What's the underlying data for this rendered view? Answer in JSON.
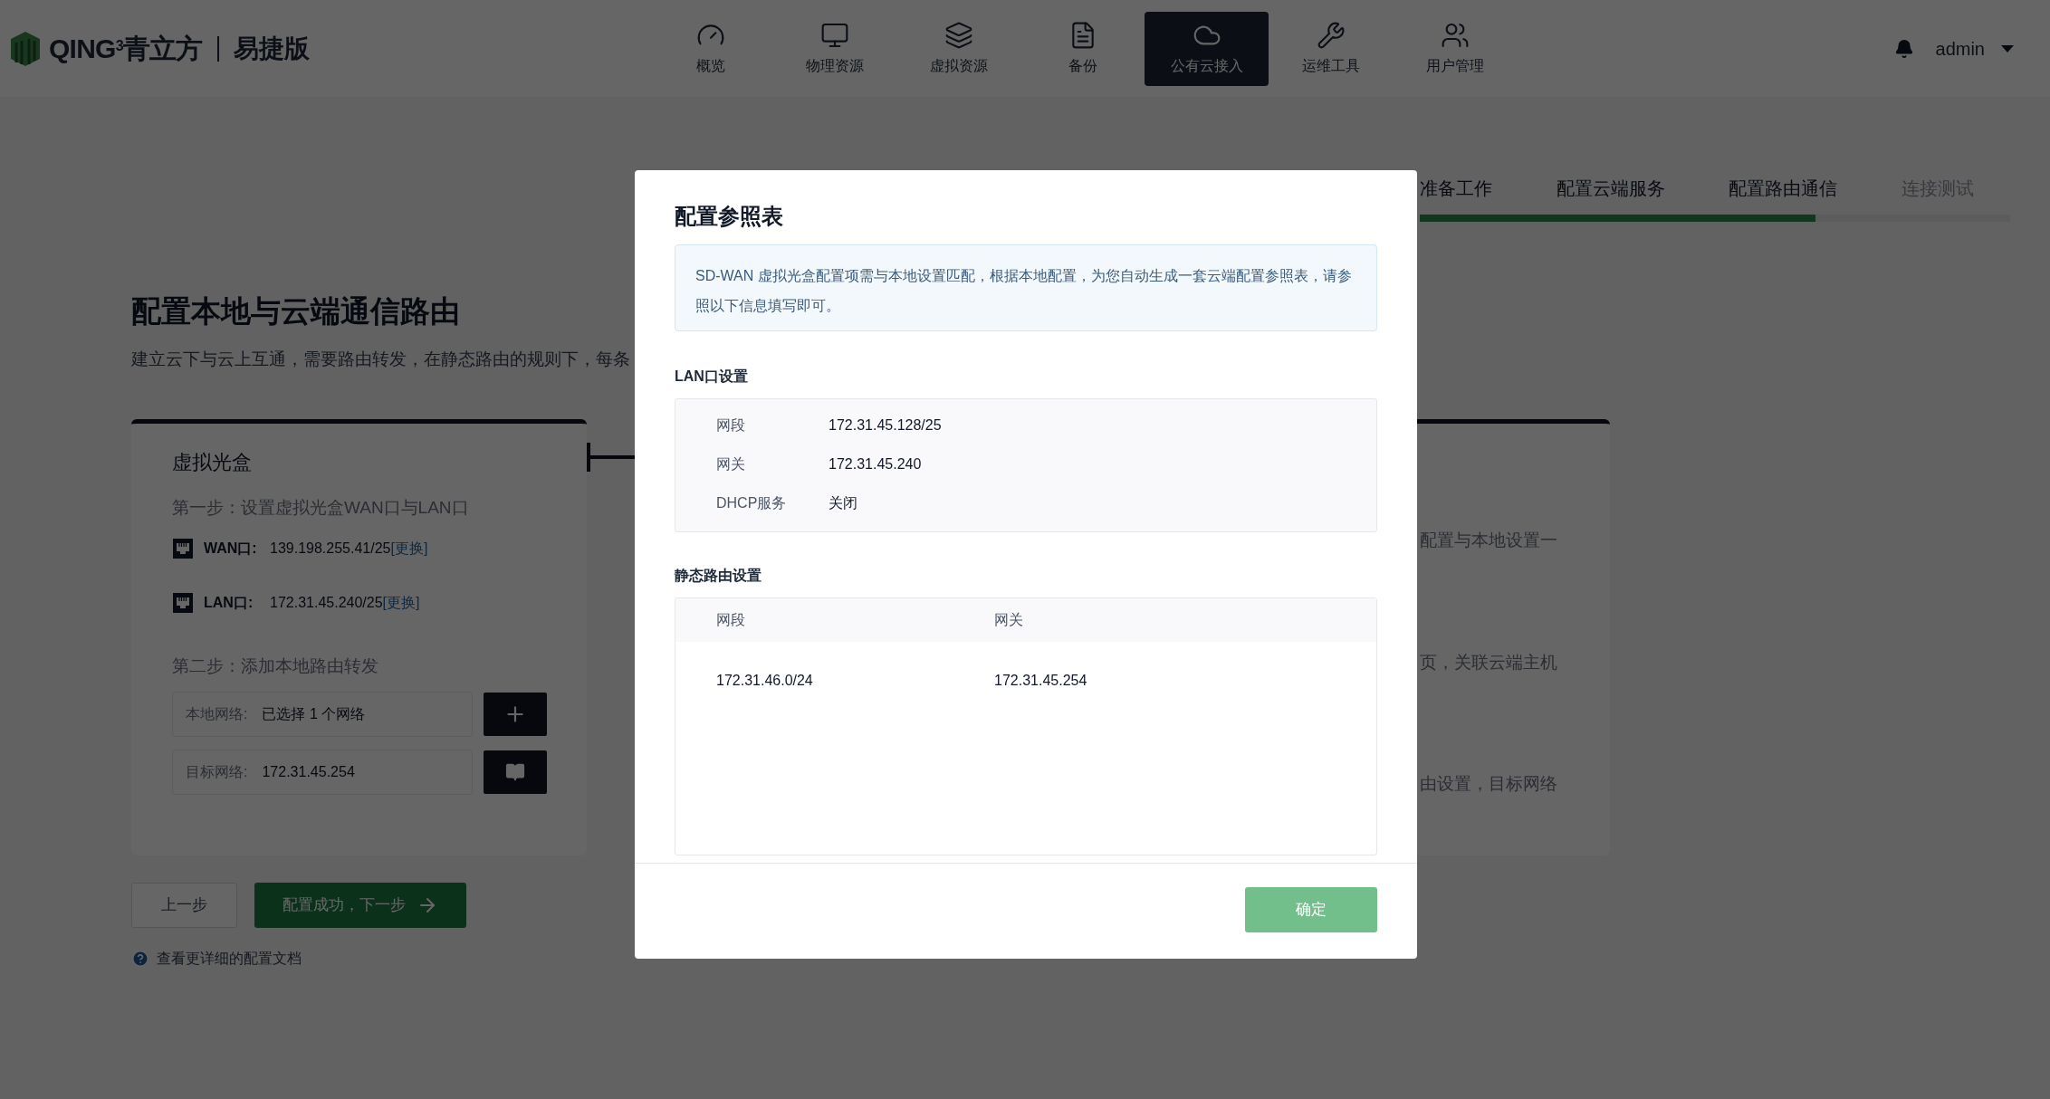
{
  "header": {
    "logo_text": "QING",
    "logo_sup": "3",
    "brand": "青立方",
    "edition": "易捷版",
    "nav": [
      {
        "label": "概览",
        "selected": false
      },
      {
        "label": "物理资源",
        "selected": false
      },
      {
        "label": "虚拟资源",
        "selected": false
      },
      {
        "label": "备份",
        "selected": false
      },
      {
        "label": "公有云接入",
        "selected": true
      },
      {
        "label": "运维工具",
        "selected": false
      },
      {
        "label": "用户管理",
        "selected": false
      }
    ],
    "user": "admin"
  },
  "steps": {
    "items": [
      {
        "label": "准备工作",
        "disabled": false
      },
      {
        "label": "配置云端服务",
        "disabled": false
      },
      {
        "label": "配置路由通信",
        "disabled": false
      },
      {
        "label": "连接测试",
        "disabled": true
      }
    ],
    "level": 0.67
  },
  "page": {
    "title": "配置本地与云端通信路由",
    "description": "建立云下与云上互通，需要路由转发，在静态路由的规则下，每条",
    "left_card": {
      "title": "虚拟光盒",
      "step1": "第一步：设置虚拟光盒WAN口与LAN口",
      "ports": [
        {
          "label": "WAN口:",
          "value": "139.198.255.41/25",
          "link": "[更换]"
        },
        {
          "label": "LAN口:",
          "value": "172.31.45.240/25",
          "link": "[更换]"
        }
      ],
      "step2": "第二步：添加本地路由转发",
      "fields": [
        {
          "label": "本地网络:",
          "value": "已选择 1 个网络",
          "kind": "add"
        },
        {
          "label": "目标网络:",
          "value": "172.31.45.254",
          "kind": "info"
        }
      ]
    },
    "right_card": {
      "lines": [
        "配置与本地设置一",
        "页，关联云端主机",
        "由设置，目标网络"
      ]
    },
    "back_button": "上一步",
    "next_button": "配置成功，下一步",
    "help_link": "查看更详细的配置文档"
  },
  "modal": {
    "title": "配置参照表",
    "notice": "SD-WAN 虚拟光盒配置项需与本地设置匹配，根据本地配置，为您自动生成一套云端配置参照表，请参照以下信息填写即可。",
    "lan": {
      "title": "LAN口设置",
      "rows": [
        {
          "label": "网段",
          "value": "172.31.45.128/25"
        },
        {
          "label": "网关",
          "value": "172.31.45.240"
        },
        {
          "label": "DHCP服务",
          "value": "关闭"
        }
      ]
    },
    "routes": {
      "title": "静态路由设置",
      "columns": [
        "网段",
        "网关"
      ],
      "rows": [
        [
          "172.31.46.0/24",
          "172.31.45.254"
        ]
      ]
    },
    "confirm": "确定"
  }
}
